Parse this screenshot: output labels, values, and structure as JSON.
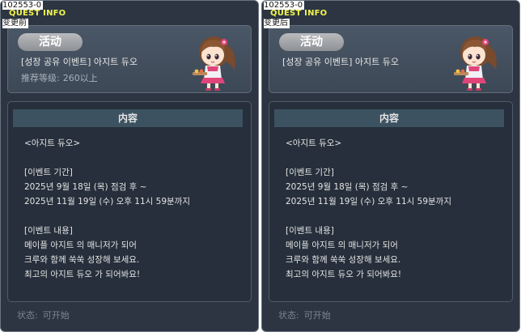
{
  "panels": [
    {
      "id": "102553-0",
      "window_label": "QUEST INFO",
      "sub_label": "变更前",
      "badge": "活动",
      "title": "[성장 공유 이벤트] 아지트 듀오",
      "level_label": "推荐等级:",
      "level_value": "260以上",
      "content_header": "内容",
      "lines": [
        "<아지트 듀오>",
        "",
        "[이벤트 기간]",
        "2025년 9월 18일 (목) 점검 후 ~",
        "2025년 11월 19일 (수) 오후 11시 59분까지",
        "",
        "[이벤트 내용]",
        "메이플 아지트 의 매니저가 되어",
        "크루와 함께 쑥쑥 성장해 보세요.",
        "최고의 아지트 듀오 가 되어봐요!"
      ],
      "status_label": "状态:",
      "status_value": "可开始"
    },
    {
      "id": "102553-0",
      "window_label": "QUEST INFO",
      "sub_label": "变更后",
      "badge": "活动",
      "title": "[성장 공유 이벤트] 아지트 듀오",
      "level_label": "",
      "level_value": "",
      "content_header": "内容",
      "lines": [
        "<아지트 듀오>",
        "",
        "[이벤트 기간]",
        "2025년 9월 18일 (목) 점검 후 ~",
        "2025년 11월 19일 (수) 오후 11시 59분까지",
        "",
        "[이벤트 내용]",
        "메이플 아지트 의 매니저가 되어",
        "크루와 함께 쑥쑥 성장해 보세요.",
        "최고의 아지트 듀오 가 되어봐요!"
      ],
      "status_label": "状态:",
      "status_value": "可开始"
    }
  ],
  "icons": {
    "character": "npc-girl-character-icon"
  },
  "colors": {
    "panel_bg": "#2c3541",
    "header_bg": "#4a5766",
    "content_bg": "#262f3b",
    "content_header_bg": "#3c5260",
    "quest_label": "#f3f34f",
    "badge": "#a8abb0",
    "status_text": "#7c8590"
  }
}
